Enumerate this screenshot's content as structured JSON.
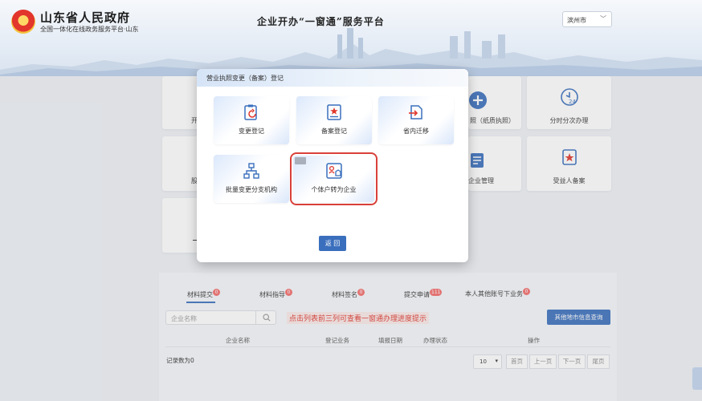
{
  "header": {
    "site_title": "山东省人民政府",
    "site_subtitle": "全国一体化在线政务服务平台·山东",
    "center_title": "企业开办“一窗通”服务平台",
    "city": "滨州市"
  },
  "tiles": [
    {
      "label": "开"
    },
    {
      "label": "照（纸质执照）"
    },
    {
      "label": "分时分次办理"
    },
    {
      "label": "股"
    },
    {
      "label": "企业管理"
    },
    {
      "label": "受益人备案"
    }
  ],
  "dialog": {
    "title": "营业执照变更（备案）登记",
    "cards": [
      {
        "label": "变更登记",
        "icon": "clipboard-refresh-icon"
      },
      {
        "label": "备案登记",
        "icon": "certificate-icon"
      },
      {
        "label": "省内迁移",
        "icon": "move-in-icon"
      },
      {
        "label": "批量变更分支机构",
        "icon": "org-tree-icon"
      },
      {
        "label": "个体户转为企业",
        "icon": "person-to-company-icon"
      }
    ],
    "back_label": "返 回"
  },
  "tabs": [
    {
      "label": "材料提交",
      "count": "0"
    },
    {
      "label": "材料指导",
      "count": "0"
    },
    {
      "label": "材料签名",
      "count": "0"
    },
    {
      "label": "提交申请",
      "count": "111"
    },
    {
      "label": "本人其他账号下业务",
      "count": "0"
    }
  ],
  "search": {
    "placeholder": "企业名称"
  },
  "hint": "点击列表前三列可查看一窗通办理进度提示",
  "other_city_btn": "其他地市信息查询",
  "table": {
    "headers": [
      "企业名称",
      "登记业务",
      "填报日期",
      "办理状态",
      "操作"
    ],
    "records": "记录数为0"
  },
  "pagination": {
    "page_size": "10",
    "first": "首页",
    "prev": "上一页",
    "next": "下一页",
    "last": "尾页"
  },
  "colors": {
    "primary": "#3a6fbd",
    "alert": "#e0362c",
    "badge": "#f56c6c"
  }
}
